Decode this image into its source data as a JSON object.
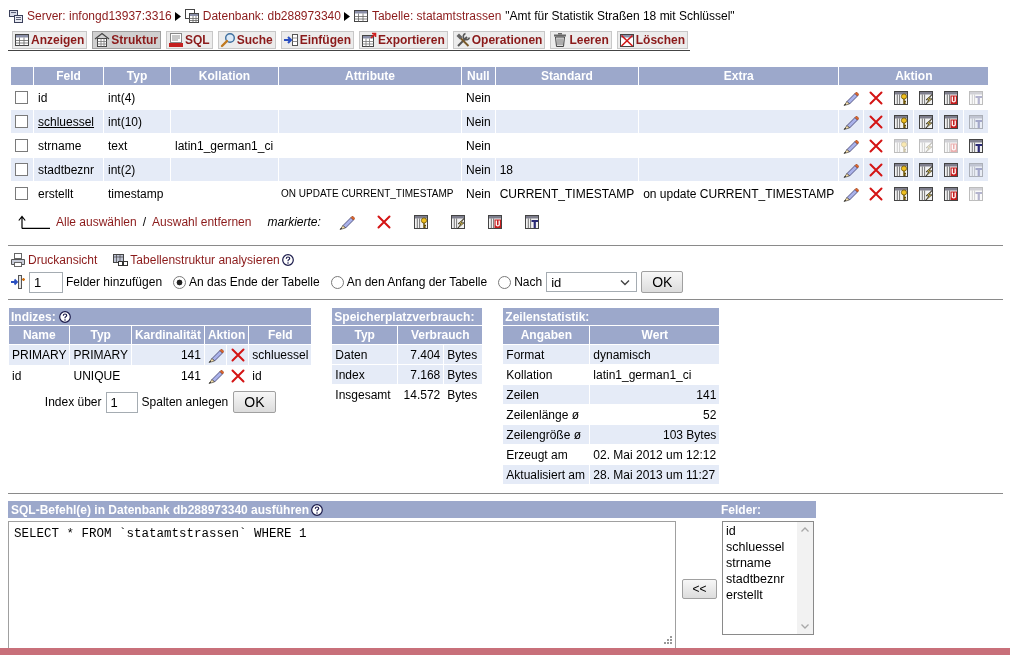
{
  "breadcrumb": {
    "items": [
      {
        "kind": "server",
        "label": "Server: infongd13937:3316"
      },
      {
        "kind": "database",
        "label": "Datenbank: db288973340"
      },
      {
        "kind": "table",
        "label": "Tabelle: statamtstrassen"
      }
    ],
    "comment": "\"Amt für Statistik Straßen 18 mit Schlüssel\""
  },
  "tabs": [
    {
      "kind": "browse",
      "label": "Anzeigen",
      "selected": false
    },
    {
      "kind": "structure",
      "label": "Struktur",
      "selected": true
    },
    {
      "kind": "sql",
      "label": "SQL",
      "selected": false
    },
    {
      "kind": "search",
      "label": "Suche",
      "selected": false
    },
    {
      "kind": "insert",
      "label": "Einfügen",
      "selected": false
    },
    {
      "kind": "export",
      "label": "Exportieren",
      "selected": false
    },
    {
      "kind": "operations",
      "label": "Operationen",
      "selected": false
    },
    {
      "kind": "empty",
      "label": "Leeren",
      "selected": false
    },
    {
      "kind": "drop",
      "label": "Löschen",
      "selected": false
    }
  ],
  "structure": {
    "columns": [
      "Feld",
      "Typ",
      "Kollation",
      "Attribute",
      "Null",
      "Standard",
      "Extra",
      "Aktion"
    ],
    "rows": [
      {
        "checked": false,
        "field": "id",
        "primary": false,
        "type": "int(4)",
        "null": "Nein",
        "actions": [
          {
            "kind": "edit",
            "disabled": false
          },
          {
            "kind": "drop",
            "disabled": false
          },
          {
            "kind": "primary",
            "disabled": false
          },
          {
            "kind": "index",
            "disabled": false
          },
          {
            "kind": "unique",
            "disabled": false
          },
          {
            "kind": "fulltext",
            "disabled": true
          }
        ]
      },
      {
        "checked": false,
        "field": "schluessel",
        "primary": true,
        "type": "int(10)",
        "null": "Nein",
        "actions": [
          {
            "kind": "edit",
            "disabled": false
          },
          {
            "kind": "drop",
            "disabled": false
          },
          {
            "kind": "primary",
            "disabled": false
          },
          {
            "kind": "index",
            "disabled": false
          },
          {
            "kind": "unique",
            "disabled": false
          },
          {
            "kind": "fulltext",
            "disabled": true
          }
        ]
      },
      {
        "checked": false,
        "field": "strname",
        "primary": false,
        "type": "text",
        "collation": "latin1_german1_ci",
        "null": "Nein",
        "actions": [
          {
            "kind": "edit",
            "disabled": false
          },
          {
            "kind": "drop",
            "disabled": false
          },
          {
            "kind": "primary",
            "disabled": true
          },
          {
            "kind": "index",
            "disabled": true
          },
          {
            "kind": "unique",
            "disabled": true
          },
          {
            "kind": "fulltext",
            "disabled": false
          }
        ]
      },
      {
        "checked": false,
        "field": "stadtbeznr",
        "primary": false,
        "type": "int(2)",
        "null": "Nein",
        "default": "18",
        "actions": [
          {
            "kind": "edit",
            "disabled": false
          },
          {
            "kind": "drop",
            "disabled": false
          },
          {
            "kind": "primary",
            "disabled": false
          },
          {
            "kind": "index",
            "disabled": false
          },
          {
            "kind": "unique",
            "disabled": false
          },
          {
            "kind": "fulltext",
            "disabled": true
          }
        ]
      },
      {
        "checked": false,
        "field": "erstellt",
        "primary": false,
        "type": "timestamp",
        "attributes": "ON UPDATE CURRENT_TIMESTAMP",
        "null": "Nein",
        "default": "CURRENT_TIMESTAMP",
        "extra": "on update CURRENT_TIMESTAMP",
        "actions": [
          {
            "kind": "edit",
            "disabled": false
          },
          {
            "kind": "drop",
            "disabled": false
          },
          {
            "kind": "primary",
            "disabled": false
          },
          {
            "kind": "index",
            "disabled": false
          },
          {
            "kind": "unique",
            "disabled": false
          },
          {
            "kind": "fulltext",
            "disabled": true
          }
        ]
      }
    ],
    "bulk": {
      "select_all": "Alle auswählen",
      "separator": "/",
      "deselect": "Auswahl entfernen",
      "label": "markierte:",
      "actions": [
        {
          "kind": "edit"
        },
        {
          "kind": "drop"
        },
        {
          "kind": "primary"
        },
        {
          "kind": "index"
        },
        {
          "kind": "unique"
        },
        {
          "kind": "fulltext"
        }
      ]
    }
  },
  "links": [
    {
      "kind": "print",
      "label": "Druckansicht",
      "help": false
    },
    {
      "kind": "analyze",
      "label": "Tabellenstruktur analysieren",
      "help": true
    }
  ],
  "add_fields": {
    "count": "1",
    "label": "Felder hinzufügen",
    "positions": [
      {
        "label": "An das Ende der Tabelle",
        "selected": true
      },
      {
        "label": "An den Anfang der Tabelle",
        "selected": false
      },
      {
        "label": "Nach",
        "selected": false
      }
    ],
    "after_field": "id",
    "button": "OK"
  },
  "indexes": {
    "title": "Indizes:",
    "columns": [
      "Name",
      "Typ",
      "Kardinalität",
      "Aktion",
      "Feld"
    ],
    "rows": [
      {
        "name": "PRIMARY",
        "type": "PRIMARY",
        "cardinality": "141",
        "actions": [
          {
            "kind": "edit"
          },
          {
            "kind": "drop"
          }
        ],
        "field": "schluessel"
      },
      {
        "name": "id",
        "type": "UNIQUE",
        "cardinality": "141",
        "actions": [
          {
            "kind": "edit"
          },
          {
            "kind": "drop"
          }
        ],
        "field": "id"
      }
    ],
    "create": {
      "prefix": "Index über",
      "count": "1",
      "suffix": "Spalten anlegen",
      "button": "OK"
    }
  },
  "storage": {
    "title": "Speicherplatzverbrauch:",
    "columns": [
      "Typ",
      "Verbrauch"
    ],
    "rows": [
      {
        "kind": "part",
        "label": "Daten",
        "value": "7.404",
        "unit": "Bytes"
      },
      {
        "kind": "part",
        "label": "Index",
        "value": "7.168",
        "unit": "Bytes"
      },
      {
        "kind": "total",
        "label": "Insgesamt",
        "value": "14.572",
        "unit": "Bytes"
      }
    ]
  },
  "row_stats": {
    "title": "Zeilenstatistik:",
    "columns": [
      "Angaben",
      "Wert"
    ],
    "rows": [
      {
        "kind": "text",
        "label": "Format",
        "value": "dynamisch"
      },
      {
        "kind": "text",
        "label": "Kollation",
        "value": "latin1_german1_ci"
      },
      {
        "kind": "number",
        "label": "Zeilen",
        "value": "141"
      },
      {
        "kind": "number",
        "label": "Zeilenlänge ø",
        "value": "52"
      },
      {
        "kind": "number",
        "label": "Zeilengröße ø",
        "value": "103 Bytes"
      },
      {
        "kind": "text",
        "label": "Erzeugt am",
        "value": "02. Mai 2012 um 12:12"
      },
      {
        "kind": "text",
        "label": "Aktualisiert am",
        "value": "28. Mai 2013 um 11:27"
      }
    ]
  },
  "sql": {
    "title": "SQL-Befehl(e) in Datenbank db288973340 ausführen",
    "query": "SELECT * FROM `statamtstrassen` WHERE 1",
    "insert_button": "<<",
    "fields_title": "Felder:",
    "fields": [
      "id",
      "schluessel",
      "strname",
      "stadtbeznr",
      "erstellt"
    ]
  }
}
